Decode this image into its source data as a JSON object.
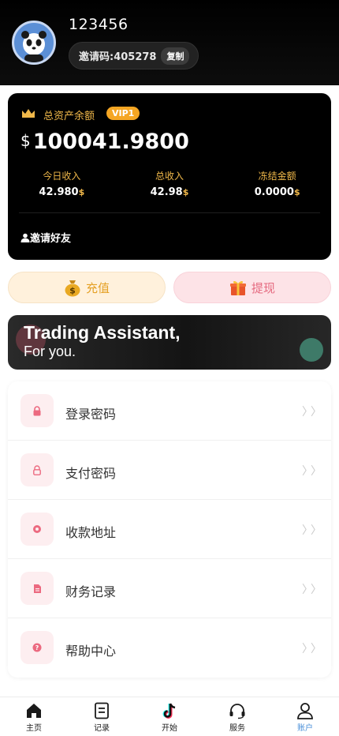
{
  "user": {
    "username": "123456",
    "invite_code_text": "邀请码:405278",
    "copy_label": "复制"
  },
  "balance": {
    "asset_label": "总资产余额",
    "vip_badge": "VIP1",
    "currency_symbol": "$",
    "amount": "100041.9800",
    "stats": [
      {
        "label": "今日收入",
        "value": "42.980",
        "currency": "$"
      },
      {
        "label": "总收入",
        "value": "42.98",
        "currency": "$"
      },
      {
        "label": "冻结金额",
        "value": "0.0000",
        "currency": "$"
      }
    ],
    "invite_friends": "邀请好友"
  },
  "actions": {
    "recharge": "充值",
    "withdraw": "提现"
  },
  "banner": {
    "title": "Trading Assistant,",
    "subtitle": "For you."
  },
  "menu": {
    "items": [
      {
        "label": "登录密码",
        "icon": "lock-icon",
        "chevron": "〉〉"
      },
      {
        "label": "支付密码",
        "icon": "lock-outline-icon",
        "chevron": "〉〉"
      },
      {
        "label": "收款地址",
        "icon": "address-icon",
        "chevron": "〉〉"
      },
      {
        "label": "财务记录",
        "icon": "document-icon",
        "chevron": "〉〉"
      },
      {
        "label": "帮助中心",
        "icon": "help-icon",
        "chevron": "〉〉"
      }
    ]
  },
  "nav": {
    "items": [
      {
        "label": "主页",
        "icon": "home-icon"
      },
      {
        "label": "记录",
        "icon": "records-icon"
      },
      {
        "label": "开始",
        "icon": "tiktok-icon"
      },
      {
        "label": "服务",
        "icon": "headset-icon"
      },
      {
        "label": "账户",
        "icon": "user-icon",
        "active": true
      }
    ]
  },
  "colors": {
    "gold": "#f0b84a",
    "vip": "#f5a623",
    "pink": "#e5697f",
    "active_nav": "#4a90d9"
  }
}
